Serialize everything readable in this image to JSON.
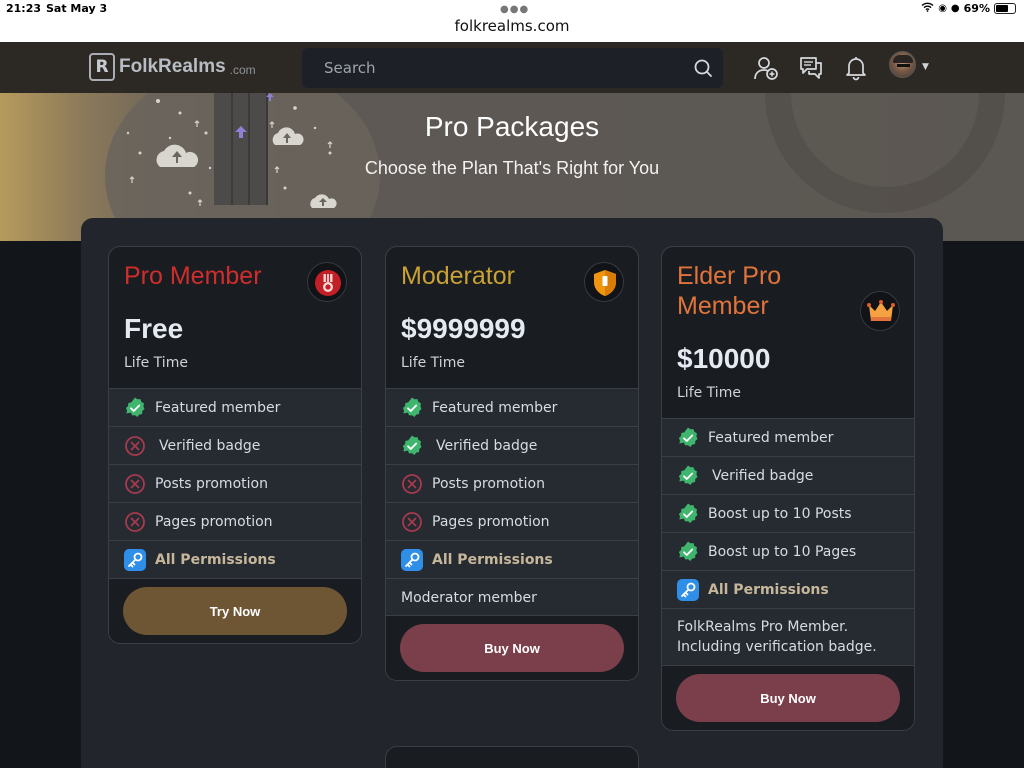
{
  "status_bar": {
    "time": "21:23",
    "date": "Sat May 3",
    "url": "folkrealms.com",
    "battery": "69%",
    "battery_level": 0.69
  },
  "navbar": {
    "logo_main": "FolkRealms",
    "logo_tld": ".com",
    "logo_letter": "R",
    "search_placeholder": "Search",
    "icons": [
      "add-user-icon",
      "messages-icon",
      "notifications-icon"
    ]
  },
  "hero": {
    "title": "Pro Packages",
    "subtitle": "Choose the Plan That's Right for You"
  },
  "colors": {
    "pro_member": "#d02d2b",
    "moderator": "#c9a233",
    "elder_pro": "#e0743a",
    "check": "#3fb56e",
    "cross": "#a63a4e",
    "key": "#2f8ee8",
    "try_button": "#6e5634",
    "buy_button": "#7a3f4a"
  },
  "plans": [
    {
      "name": "Pro Member",
      "price": "Free",
      "period": "Life Time",
      "icon": "medal-icon",
      "features": [
        {
          "text": "Featured member",
          "status": "included"
        },
        {
          "text": "Verified badge",
          "status": "excluded"
        },
        {
          "text": "Posts promotion",
          "status": "excluded"
        },
        {
          "text": "Pages promotion",
          "status": "excluded"
        }
      ],
      "permissions_label": "All Permissions",
      "note": "",
      "button_label": "Try Now"
    },
    {
      "name": "Moderator",
      "price": "$9999999",
      "period": "Life Time",
      "icon": "shield-icon",
      "features": [
        {
          "text": "Featured member",
          "status": "included"
        },
        {
          "text": "Verified badge",
          "status": "included"
        },
        {
          "text": "Posts promotion",
          "status": "excluded"
        },
        {
          "text": "Pages promotion",
          "status": "excluded"
        }
      ],
      "permissions_label": "All Permissions",
      "note": "Moderator member",
      "button_label": "Buy Now"
    },
    {
      "name": "Elder Pro Member",
      "price": "$10000",
      "period": "Life Time",
      "icon": "crown-icon",
      "features": [
        {
          "text": "Featured member",
          "status": "included"
        },
        {
          "text": "Verified badge",
          "status": "included"
        },
        {
          "text": "Boost up to 10 Posts",
          "status": "included"
        },
        {
          "text": "Boost up to 10 Pages",
          "status": "included"
        }
      ],
      "permissions_label": "All Permissions",
      "note": "FolkRealms Pro Member. Including verification badge.",
      "button_label": "Buy Now"
    }
  ]
}
